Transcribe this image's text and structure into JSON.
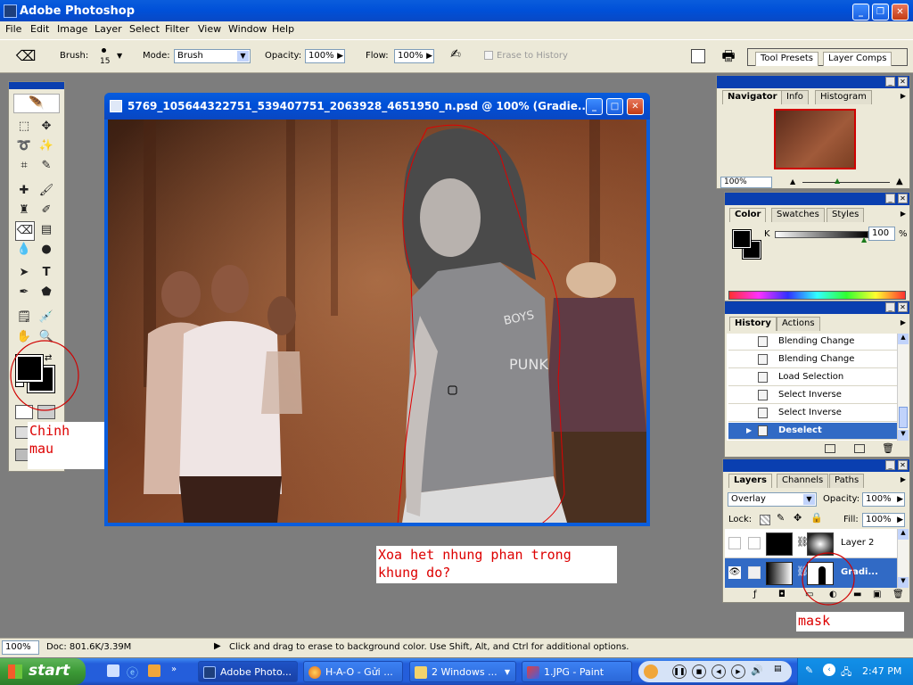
{
  "app": {
    "title": "Adobe Photoshop"
  },
  "menu": [
    "File",
    "Edit",
    "Image",
    "Layer",
    "Select",
    "Filter",
    "View",
    "Window",
    "Help"
  ],
  "options_bar": {
    "brush_label": "Brush:",
    "brush_size": "15",
    "mode_label": "Mode:",
    "mode_value": "Brush",
    "opacity_label": "Opacity:",
    "opacity_value": "100%",
    "flow_label": "Flow:",
    "flow_value": "100%",
    "erase_history_label": "Erase to History",
    "tool_presets_tab": "Tool Presets",
    "layer_comps_tab": "Layer Comps"
  },
  "document": {
    "title": "5769_105644322751_539407751_2063928_4651950_n.psd @ 100% (Gradie..."
  },
  "navigator": {
    "tabs": [
      "Navigator",
      "Info",
      "Histogram"
    ],
    "zoom": "100%"
  },
  "color_panel": {
    "tabs": [
      "Color",
      "Swatches",
      "Styles"
    ],
    "channel_label": "K",
    "channel_value": "100",
    "unit": "%"
  },
  "history": {
    "tabs": [
      "History",
      "Actions"
    ],
    "items": [
      "Blending Change",
      "Blending Change",
      "Load Selection",
      "Select Inverse",
      "Select Inverse",
      "Deselect"
    ],
    "selected_index": 5
  },
  "layers": {
    "tabs": [
      "Layers",
      "Channels",
      "Paths"
    ],
    "blend_mode": "Overlay",
    "opacity_label": "Opacity:",
    "opacity_value": "100%",
    "lock_label": "Lock:",
    "fill_label": "Fill:",
    "fill_value": "100%",
    "rows": [
      {
        "name": "Layer 2",
        "visible": false,
        "selected": false
      },
      {
        "name": "Gradi...",
        "visible": true,
        "selected": true
      }
    ]
  },
  "annotations": {
    "color_note_line1": "Chinh",
    "color_note_line2": "mau",
    "erase_note_line1": "Xoa het nhung phan trong",
    "erase_note_line2": "khung do?",
    "mask_note": "mask"
  },
  "status_bar": {
    "zoom": "100%",
    "doc": "Doc: 801.6K/3.39M",
    "hint": "Click and drag to erase to background color.  Use Shift, Alt, and Ctrl for additional options."
  },
  "taskbar": {
    "start": "start",
    "buttons": [
      "Adobe Photo...",
      "H-A-O - Gửi ...",
      "2 Windows ...",
      "1.JPG - Paint"
    ],
    "clock": "2:47 PM"
  },
  "colors": {
    "xp_blue": "#0a5ddc",
    "taskbar_blue": "#245edb",
    "start_green": "#3c9a36",
    "selection_blue": "#316ac5",
    "annotation_red": "#dd0000"
  }
}
